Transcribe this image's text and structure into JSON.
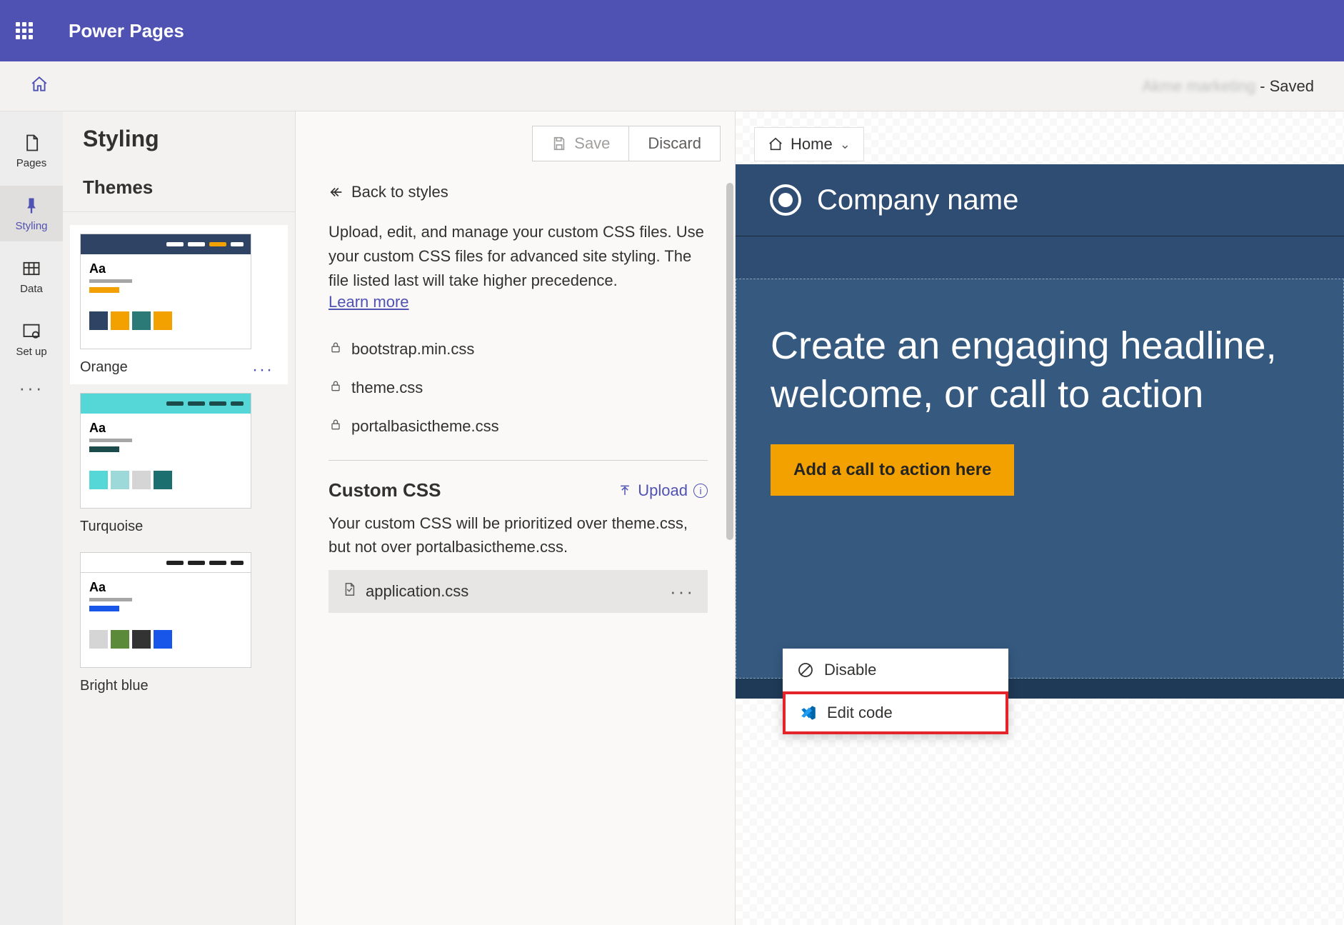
{
  "app": {
    "title": "Power Pages"
  },
  "site": {
    "name": "Akme marketing",
    "state": "- Saved"
  },
  "rail": {
    "items": [
      {
        "label": "Pages"
      },
      {
        "label": "Styling"
      },
      {
        "label": "Data"
      },
      {
        "label": "Set up"
      }
    ]
  },
  "style_panel": {
    "title": "Styling",
    "save": "Save",
    "discard": "Discard",
    "themes_heading": "Themes",
    "themes": [
      {
        "name": "Orange"
      },
      {
        "name": "Turquoise"
      },
      {
        "name": "Bright blue"
      }
    ]
  },
  "detail": {
    "back": "Back to styles",
    "description": "Upload, edit, and manage your custom CSS files. Use your custom CSS files for advanced site styling. The file listed last will take higher precedence.",
    "learn_more": "Learn more",
    "locked_files": [
      "bootstrap.min.css",
      "theme.css",
      "portalbasictheme.css"
    ],
    "custom_heading": "Custom CSS",
    "upload_label": "Upload",
    "custom_desc": "Your custom CSS will be prioritized over theme.css, but not over portalbasictheme.css.",
    "custom_file": "application.css"
  },
  "context_menu": {
    "disable": "Disable",
    "edit_code": "Edit code"
  },
  "preview": {
    "breadcrumb": "Home",
    "company": "Company name",
    "headline": "Create an engaging headline, welcome, or call to action",
    "cta": "Add a call to action here"
  }
}
